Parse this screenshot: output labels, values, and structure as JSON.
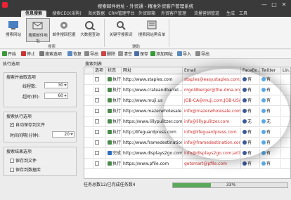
{
  "window": {
    "title": "搜索邮件地址 - 外贸通 - 精准外贸客户管理系统",
    "buttons": [
      "—",
      "□",
      "✕"
    ]
  },
  "ribbon": {
    "tabs": [
      "信息搜索",
      "搜索CEO(采购)",
      "海关数据",
      "CRM管理平台",
      "外贸邮箱",
      "外贸客户管理",
      "流量营销管道",
      "生成",
      "工具"
    ],
    "groups": [
      {
        "label": "搜索",
        "buttons": [
          "搜索网站",
          "搜索邮件地址",
          "邮件搜回挖掘",
          "大数据查询"
        ]
      },
      {
        "label": "辅助",
        "buttons": [
          "关键字搜索词",
          "搜索网站黑名单"
        ]
      }
    ]
  },
  "toolbar": {
    "items": [
      "开始",
      "停止",
      "搜索选项",
      "恢复",
      "导出",
      "删除",
      "清空",
      "保存",
      "添加网址",
      "导入",
      "导出"
    ]
  },
  "left_panel": {
    "title": "执行选项",
    "group1": {
      "title": "搜索并抽取选项",
      "threads_label": "线程数:",
      "threads_value": "30",
      "timeout_label": "超时(秒):",
      "timeout_value": "60"
    },
    "group2": {
      "title": "搜索执行选项",
      "auto_save_label": "自动保存到文件",
      "interval_label": "时间间隔(分钟):",
      "interval_value": "20"
    },
    "group3": {
      "title": "搜索结果选项",
      "opt1_label": "保存到文件",
      "opt2_label": "保存到数据库"
    }
  },
  "grid": {
    "title": "搜索列表",
    "columns": [
      "选项",
      "状态",
      "网址",
      "Email",
      "FaceBo...",
      "Twitter",
      "Lin..."
    ],
    "rows": [
      {
        "state": "执行",
        "url": "http://www.staples.com",
        "email": "staples@easy.staples.com;o...",
        "fb": "有",
        "tw": "有",
        "done": false
      },
      {
        "state": "执行",
        "url": "http://www.crateandbarrel....",
        "email": "mgoldberger@the-dma.org;r...",
        "fb": "有",
        "tw": "有",
        "done": false
      },
      {
        "state": "执行",
        "url": "http://www.muji.us",
        "email": "JOB-CA@muji.com;JOB-US@...",
        "fb": "有",
        "tw": "有",
        "done": false
      },
      {
        "state": "执行",
        "url": "http://www.mazerwholesale...",
        "email": "info@mazerwholesale.com",
        "fb": "有",
        "tw": "有",
        "done": false
      },
      {
        "state": "执行",
        "url": "https://www.lillypulitzer.com",
        "email": "info@lillypulitzer.com",
        "fb": "无",
        "tw": "无",
        "done": false
      },
      {
        "state": "执行",
        "url": "http://lifeguardpress.com",
        "email": "info@lifeguardpress.com",
        "fb": "有",
        "tw": "有",
        "done": false
      },
      {
        "state": "执行",
        "url": "http://www.framedestination...",
        "email": "info@framedestination.com",
        "fb": "有",
        "tw": "有",
        "done": false
      },
      {
        "state": "完成",
        "url": "http://www.displays2go.com",
        "email": "info@displays2go.com;arthr...",
        "fb": "有",
        "tw": "有",
        "done": true
      },
      {
        "state": "执行",
        "url": "https://www.pfile.com",
        "email": "getsmart@pfile.com",
        "fb": "有",
        "tw": "有",
        "done": false
      }
    ]
  },
  "status": {
    "summary": "任务总数12/已完成任务数4",
    "progress_text": "33%",
    "progress": 0.33
  },
  "colors": {
    "titlebar": "#3a3a3a",
    "email": "#d03030",
    "progress": "#5aaa5a"
  }
}
